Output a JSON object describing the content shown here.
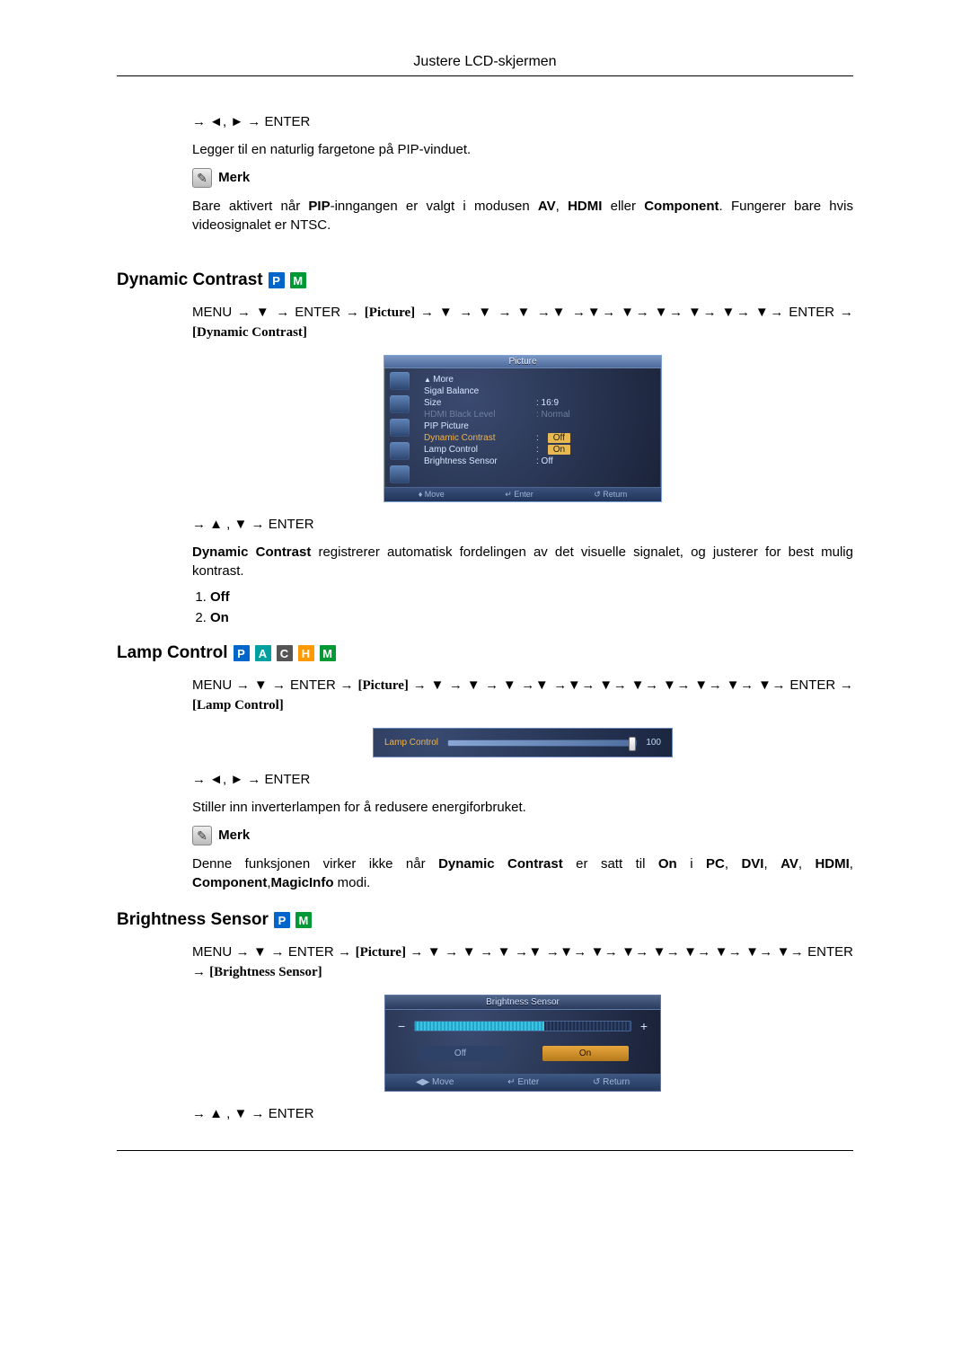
{
  "header": {
    "title": "Justere LCD-skjermen"
  },
  "intro": {
    "nav": "→ ◄, ► → ENTER",
    "text": "Legger til en naturlig fargetone på PIP-vinduet.",
    "merk_label": "Merk",
    "merk_text_parts": {
      "t1": "Bare aktivert når ",
      "pip": "PIP",
      "t2": "-inngangen er valgt i modusen ",
      "av": "AV",
      "t3": ", ",
      "hdmi": "HDMI",
      "t4": " eller ",
      "comp": "Component",
      "t5": ". Fungerer bare hvis videosignalet er NTSC."
    }
  },
  "dynamic_contrast": {
    "heading": "Dynamic Contrast",
    "badges": [
      "P",
      "M"
    ],
    "nav1_parts": {
      "menu": "MENU → ▼ → ENTER → ",
      "pict": "[Picture]",
      "arrows": " → ▼ → ▼ → ▼ →▼ →▼→ ▼→ ▼→ ▼→ ▼→ ▼→ ENTER → ",
      "bracket": "[Dynamic Contrast]"
    },
    "nav2": "→ ▲ , ▼ → ENTER",
    "desc_bold": "Dynamic Contrast",
    "desc_rest": "  registrerer automatisk fordelingen av det visuelle signalet, og justerer for best mulig kontrast.",
    "opt_off": "Off",
    "opt_on": "On",
    "osd": {
      "title": "Picture",
      "rows": {
        "more": "More",
        "sigal": "Sigal Balance",
        "size_lbl": "Size",
        "size_val": ":   16:9",
        "hbl_lbl": "HDMI Black Level",
        "hbl_val": ":   Normal",
        "pip": "PIP Picture",
        "dyn_lbl": "Dynamic Contrast",
        "dyn_val": "Off",
        "lamp_lbl": "Lamp Control",
        "lamp_val": "On",
        "bright_lbl": "Brightness Sensor",
        "bright_val": ":   Off"
      },
      "foot": {
        "move": "Move",
        "enter": "Enter",
        "ret": "Return"
      }
    }
  },
  "lamp_control": {
    "heading": "Lamp Control",
    "badges": [
      "P",
      "A",
      "C",
      "H",
      "M"
    ],
    "nav1_parts": {
      "menu": "MENU → ▼ → ENTER → ",
      "pict": "[Picture]",
      "arrows": " → ▼ → ▼ → ▼ →▼ →▼→ ▼→ ▼→ ▼→ ▼→ ▼→ ▼→ ENTER → ",
      "bracket": "[Lamp Control]"
    },
    "slider": {
      "label": "Lamp Control",
      "value": "100"
    },
    "nav2": "→ ◄, ► → ENTER",
    "desc": "Stiller inn inverterlampen for å redusere energiforbruket.",
    "merk_label": "Merk",
    "merk_parts": {
      "t1": "Denne funksjonen virker ikke når ",
      "dc": "Dynamic Contrast",
      "t2": " er satt til ",
      "on": "On",
      "t3": " i ",
      "pc": "PC",
      "c1": ", ",
      "dvi": "DVI",
      "c2": ", ",
      "av": "AV",
      "c3": ", ",
      "hdmi": "HDMI",
      "c4": ", ",
      "comp": "Component",
      "c5": ",",
      "mi": "MagicInfo",
      "t4": " modi."
    }
  },
  "brightness_sensor": {
    "heading": "Brightness Sensor",
    "badges": [
      "P",
      "M"
    ],
    "nav1_parts": {
      "menu": "MENU → ▼ → ENTER → ",
      "pict": "[Picture]",
      "arrows": " → ▼ → ▼ → ▼ →▼ →▼→ ▼→ ▼→ ▼→ ▼→ ▼→ ▼→ ▼→ ENTER → ",
      "bracket": "[Brightness Sensor]"
    },
    "osd": {
      "title": "Brightness Sensor",
      "off": "Off",
      "on": "On",
      "foot": {
        "move": "Move",
        "enter": "Enter",
        "ret": "Return"
      }
    },
    "nav2": "→ ▲ , ▼ → ENTER"
  }
}
